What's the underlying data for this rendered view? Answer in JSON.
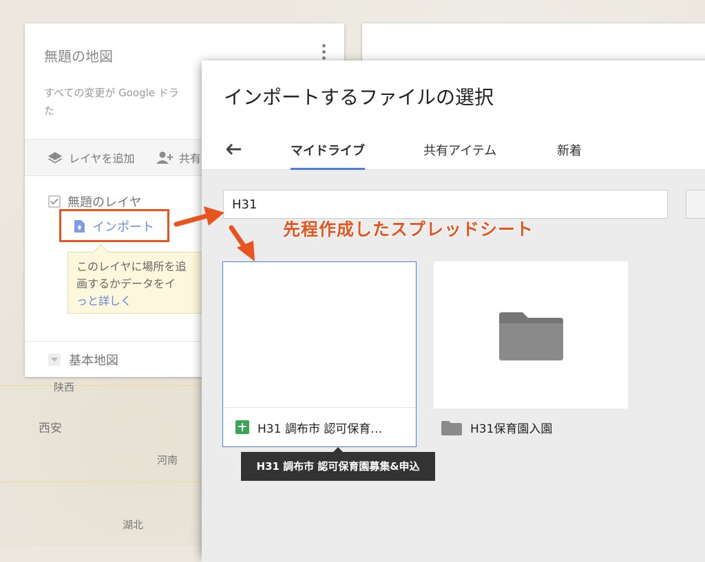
{
  "map": {
    "labels": [
      "陕西",
      "西安",
      "河南",
      "湖北"
    ]
  },
  "left_panel": {
    "title": "無題の地図",
    "description": "すべての変更が Google ドラ\nた",
    "toolbar": {
      "add_layer": "レイヤを追加",
      "share": "共有"
    },
    "layer_name": "無題のレイヤ",
    "import_label": "インポート",
    "hint_line1": "このレイヤに場所を追",
    "hint_line2": "画するかデータをイ",
    "hint_link": "っと詳しく",
    "base_map": "基本地図"
  },
  "dialog": {
    "title": "インポートするファイルの選択",
    "tabs": [
      {
        "label": "マイドライブ",
        "active": true
      },
      {
        "label": "共有アイテム",
        "active": false
      },
      {
        "label": "新着",
        "active": false
      }
    ],
    "search_value": "H31",
    "annotation": "先程作成したスプレッドシート",
    "files": [
      {
        "name": "H31 調布市 認可保育…",
        "type": "spreadsheet"
      },
      {
        "name": "H31保育園入園",
        "type": "folder"
      }
    ],
    "tooltip": "H31 調布市 認可保育園募集&申込"
  },
  "colors": {
    "accent": "#4d7ddf",
    "annotation": "#e9531d",
    "sheet": "#3aa757"
  }
}
